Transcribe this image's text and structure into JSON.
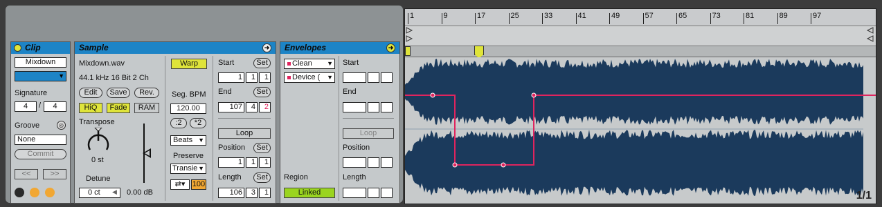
{
  "clip": {
    "title": "Clip",
    "name": "Mixdown",
    "signature_label": "Signature",
    "sig_num": "4",
    "sig_sep": "/",
    "sig_den": "4",
    "groove_label": "Groove",
    "groove_value": "None",
    "commit_label": "Commit",
    "nudge_left": "<<",
    "nudge_right": ">>"
  },
  "sample": {
    "title": "Sample",
    "filename": "Mixdown.wav",
    "format": "44.1 kHz 16 Bit 2 Ch",
    "edit_label": "Edit",
    "save_label": "Save",
    "rev_label": "Rev.",
    "hiq_label": "HiQ",
    "fade_label": "Fade",
    "ram_label": "RAM",
    "transpose_label": "Transpose",
    "transpose_value": "0 st",
    "detune_label": "Detune",
    "detune_value": "0 ct",
    "gain_value": "0.00 dB",
    "warp_label": "Warp",
    "segbpm_label": "Seg. BPM",
    "segbpm_value": "120.00",
    "half_label": ":2",
    "double_label": "*2",
    "warpmode_value": "Beats",
    "preserve_label": "Preserve",
    "preserve_value": "Transie",
    "loopmode_icon": "⇄▾",
    "envelope_value": "100",
    "start_label": "Start",
    "start_set": "Set",
    "start_values": [
      "1",
      "1",
      "1"
    ],
    "end_label": "End",
    "end_set": "Set",
    "end_values": [
      "107",
      "4",
      "2"
    ],
    "loop_label": "Loop",
    "position_label": "Position",
    "position_set": "Set",
    "position_values": [
      "1",
      "1",
      "1"
    ],
    "length_label": "Length",
    "length_set": "Set",
    "length_values": [
      "106",
      "3",
      "1"
    ]
  },
  "envelopes": {
    "title": "Envelopes",
    "device_chooser": "Clean",
    "control_chooser": "Device (",
    "start_label": "Start",
    "end_label": "End",
    "loop_label": "Loop",
    "position_label": "Position",
    "region_label": "Region",
    "linked_label": "Linked",
    "length_label": "Length"
  },
  "ruler": {
    "ticks": [
      "1",
      "9",
      "17",
      "25",
      "33",
      "41",
      "49",
      "57",
      "65",
      "73",
      "81",
      "89",
      "97"
    ]
  },
  "corner_label": "1/1",
  "colors": {
    "accent": "#1d84c6",
    "waveform": "#1b3a5c",
    "envelope": "#e0245e",
    "warp_yellow": "#dfe43a",
    "linked_green": "#9ad41f"
  }
}
